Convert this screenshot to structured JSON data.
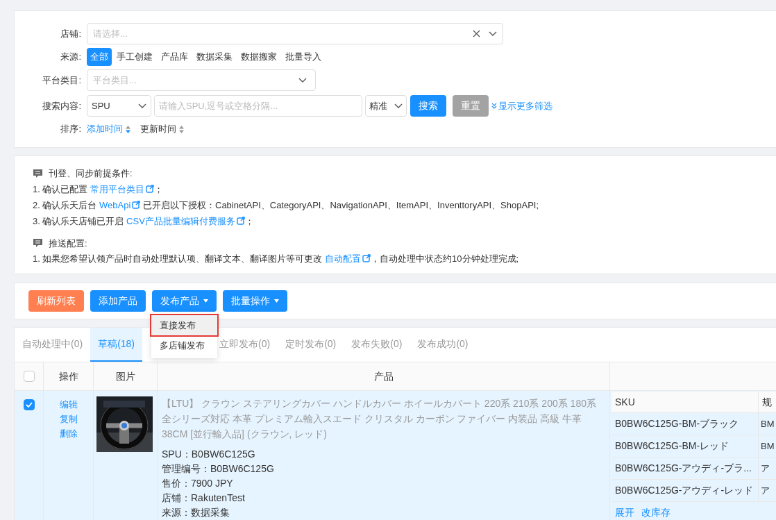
{
  "filters": {
    "shop": {
      "label": "店铺:",
      "placeholder": "请选择..."
    },
    "source": {
      "label": "来源:",
      "options": [
        {
          "label": "全部",
          "selected": true
        },
        {
          "label": "手工创建",
          "selected": false
        },
        {
          "label": "产品库",
          "selected": false
        },
        {
          "label": "数据采集",
          "selected": false
        },
        {
          "label": "数据搬家",
          "selected": false
        },
        {
          "label": "批量导入",
          "selected": false
        }
      ]
    },
    "category": {
      "label": "平台类目:",
      "placeholder": "平台类目..."
    },
    "search": {
      "label": "搜索内容:",
      "field": "SPU",
      "placeholder": "请输入SPU,逗号或空格分隔...",
      "match": "精准",
      "search_button": "搜索",
      "reset_button": "重置",
      "more_link": "显示更多筛选"
    },
    "sort": {
      "label": "排序:",
      "options": [
        {
          "label": "添加时间",
          "selected": true
        },
        {
          "label": "更新时间",
          "selected": false
        }
      ]
    }
  },
  "notice": [
    {
      "title": "刊登、同步前提条件:",
      "items": [
        [
          {
            "kind": "text",
            "text": "1. 确认已配置 "
          },
          {
            "kind": "link",
            "text": "常用平台类目"
          },
          {
            "kind": "text",
            "text": "；"
          }
        ],
        [
          {
            "kind": "text",
            "text": "2. 确认乐天后台 "
          },
          {
            "kind": "link",
            "text": "WebApi"
          },
          {
            "kind": "text",
            "text": " 已开启以下授权：CabinetAPI、CategoryAPI、NavigationAPI、ItemAPI、InventtoryAPI、ShopAPI;"
          }
        ],
        [
          {
            "kind": "text",
            "text": "3. 确认乐天店铺已开启 "
          },
          {
            "kind": "link",
            "text": "CSV产品批量编辑付费服务"
          },
          {
            "kind": "text",
            "text": "；"
          }
        ]
      ]
    },
    {
      "title": "推送配置:",
      "items": [
        [
          {
            "kind": "text",
            "text": "1. 如果您希望认领产品时自动处理默认项、翻译文本、翻译图片等可更改 "
          },
          {
            "kind": "link",
            "text": "自动配置"
          },
          {
            "kind": "text",
            "text": "，自动处理中状态约10分钟处理完成;"
          }
        ]
      ]
    }
  ],
  "toolbar": [
    {
      "label": "刷新列表",
      "kind": "refresh"
    },
    {
      "label": "添加产品",
      "kind": "primary"
    },
    {
      "label": "发布产品",
      "kind": "dropdown"
    },
    {
      "label": "批量操作",
      "kind": "dropdown"
    }
  ],
  "publish_menu": [
    {
      "label": "直接发布",
      "selected": true
    },
    {
      "label": "多店铺发布",
      "selected": false
    }
  ],
  "tabs": [
    {
      "label": "自动处理中(0)",
      "selected": false
    },
    {
      "label": "草稿(18)",
      "selected": true
    },
    {
      "label": "立即发布(0)",
      "selected": false
    },
    {
      "label": "定时发布(0)",
      "selected": false
    },
    {
      "label": "发布失败(0)",
      "selected": false
    },
    {
      "label": "发布成功(0)",
      "selected": false
    }
  ],
  "table": {
    "select_all": {
      "checked": false
    },
    "columns": [
      "操作",
      "图片",
      "产品"
    ],
    "rows": [
      {
        "checked": true,
        "actions": [
          "编辑",
          "复制",
          "删除"
        ],
        "image": {
          "kind": "picture"
        },
        "title": "【LTU】 クラウン ステアリングカバー ハンドルカバー ホイールカバート 220系 210系 200系 180系全シリーズ対応 本革 プレミアム輸入スエード クリスタル カーボン ファイバー 内装品 高級 牛革 38CM [並行輸入品] (クラウン, レッド)",
        "details": [
          "SPU：B0BW6C125G",
          "管理编号：B0BW6C125G",
          "售价：7900 JPY",
          "店铺：RakutenTest",
          "来源：数据采集"
        ],
        "sku_columns": [
          "SKU",
          "规"
        ],
        "skus": [
          {
            "sku": "B0BW6C125G-BM-ブラック",
            "column_2": "BM"
          },
          {
            "sku": "B0BW6C125G-BM-レッド",
            "column_2": "BM"
          },
          {
            "sku": "B0BW6C125G-アウディ-ブラ...",
            "column_2": "ア"
          },
          {
            "sku": "B0BW6C125G-アウディ-レッド",
            "column_2": "ア"
          }
        ],
        "sku_links": [
          "展开",
          "改库存"
        ]
      }
    ]
  }
}
